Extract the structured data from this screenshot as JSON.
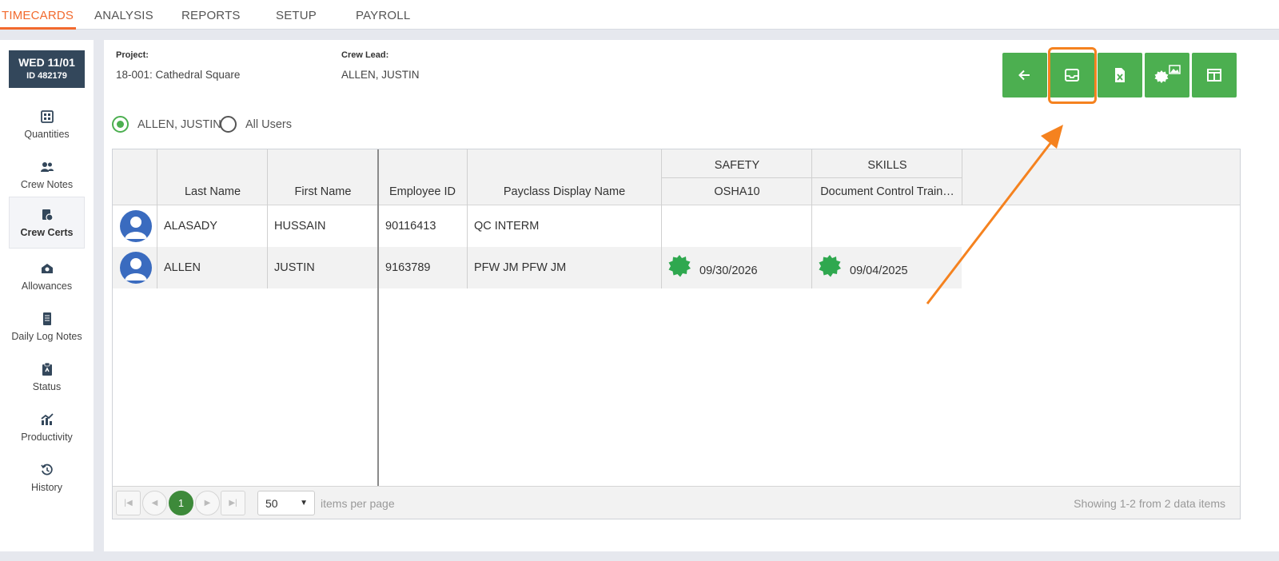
{
  "nav": {
    "tabs": [
      {
        "label": "TIMECARDS",
        "active": true
      },
      {
        "label": "ANALYSIS"
      },
      {
        "label": "REPORTS"
      },
      {
        "label": "SETUP"
      },
      {
        "label": "PAYROLL"
      }
    ]
  },
  "sidebar": {
    "date": "WED 11/01",
    "id": "ID 482179",
    "items": [
      {
        "label": "Quantities",
        "icon": "quantities-icon"
      },
      {
        "label": "Crew Notes",
        "icon": "crew-notes-icon"
      },
      {
        "label": "Crew Certs",
        "icon": "crew-certs-icon",
        "active": true
      },
      {
        "label": "Allowances",
        "icon": "allowances-icon"
      },
      {
        "label": "Daily Log Notes",
        "icon": "daily-log-notes-icon"
      },
      {
        "label": "Status",
        "icon": "status-icon"
      },
      {
        "label": "Productivity",
        "icon": "productivity-icon"
      },
      {
        "label": "History",
        "icon": "history-icon"
      }
    ]
  },
  "header": {
    "project_label": "Project:",
    "project_value": "18-001: Cathedral Square",
    "crew_lead_label": "Crew Lead:",
    "crew_lead_value": "ALLEN, JUSTIN"
  },
  "toolbar": {
    "buttons": [
      "back-arrow-icon",
      "email-icon",
      "excel-export-icon",
      "cert-image-icon",
      "split-view-icon"
    ],
    "highlighted": "email-icon",
    "color": "#4caf50",
    "highlight_color": "#f5821f"
  },
  "filter": {
    "option_1": "ALLEN, JUSTIN",
    "option_2": "All Users",
    "selected": "ALLEN, JUSTIN"
  },
  "grid": {
    "group_headers": [
      "SAFETY",
      "SKILLS"
    ],
    "columns": [
      "Last Name",
      "First Name",
      "Employee ID",
      "Payclass Display Name",
      "OSHA10",
      "Document Control Train…"
    ],
    "rows": [
      {
        "last": "ALASADY",
        "first": "HUSSAIN",
        "emp_id": "90116413",
        "payclass": "QC INTERM",
        "osha10": "",
        "doc_control": ""
      },
      {
        "last": "ALLEN",
        "first": "JUSTIN",
        "emp_id": "9163789",
        "payclass": "PFW JM PFW JM",
        "osha10": "09/30/2026",
        "doc_control": "09/04/2025"
      }
    ]
  },
  "pager": {
    "current_page": "1",
    "page_size": "50",
    "items_per_page_label": "items per page",
    "summary": "Showing 1-2 from 2 data items"
  }
}
